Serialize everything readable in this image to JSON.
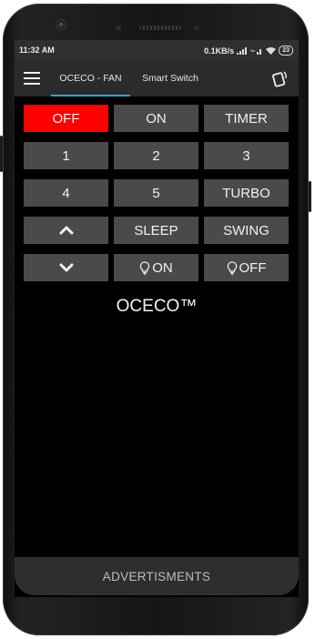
{
  "status_bar": {
    "time": "11:32 AM",
    "speed": "0.1KB/s",
    "battery": "23"
  },
  "app_bar": {
    "tabs": [
      {
        "label": "OCECO - FAN",
        "active": true
      },
      {
        "label": "Smart Switch",
        "active": false
      }
    ],
    "menu_icon": "hamburger-menu-icon",
    "action_icon": "remote-card-icon"
  },
  "remote": {
    "off": "OFF",
    "on": "ON",
    "timer": "TIMER",
    "speed_1": "1",
    "speed_2": "2",
    "speed_3": "3",
    "speed_4": "4",
    "speed_5": "5",
    "turbo": "TURBO",
    "sleep": "SLEEP",
    "swing": "SWING",
    "light_on": "ON",
    "light_off": "OFF",
    "up_icon": "chevron-up-icon",
    "down_icon": "chevron-down-icon",
    "bulb_icon": "bulb-icon"
  },
  "brand": "OCECO™",
  "ad_label": "ADVERTISMENTS",
  "colors": {
    "accent": "#2aa6c9",
    "off_button": "#ff0000",
    "button": "#4a4a4a",
    "background": "#000000"
  }
}
